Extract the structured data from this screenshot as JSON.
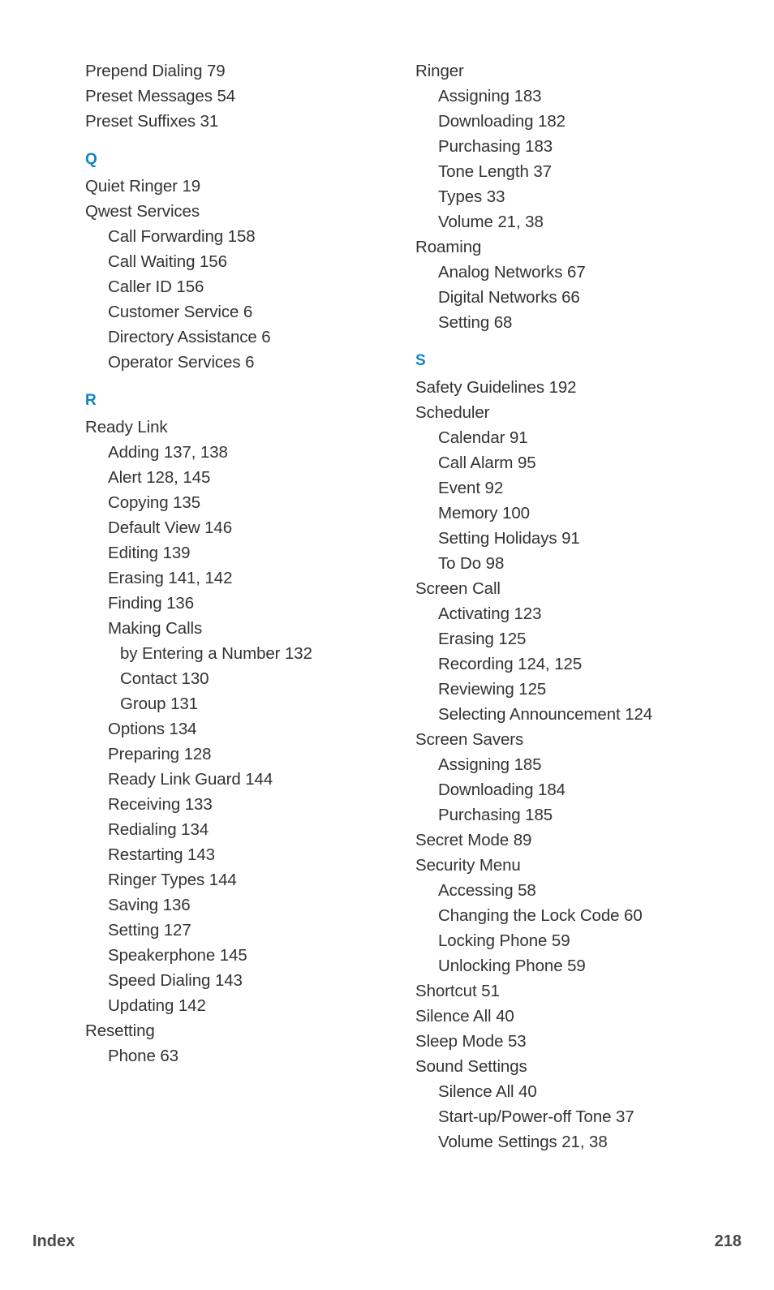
{
  "page": {
    "footer_label": "Index",
    "footer_page": "218",
    "accent_color": "#1283c3",
    "text_color": "#333333",
    "footer_color": "#4a4a4a",
    "background_color": "#ffffff"
  },
  "columns": [
    {
      "name": "left-column",
      "blocks": [
        {
          "type": "entry",
          "level": 1,
          "text": "Prepend Dialing 79"
        },
        {
          "type": "entry",
          "level": 1,
          "text": "Preset Messages 54"
        },
        {
          "type": "entry",
          "level": 1,
          "text": "Preset Suffixes 31"
        },
        {
          "type": "heading",
          "letter": "Q"
        },
        {
          "type": "entry",
          "level": 1,
          "text": "Quiet Ringer 19"
        },
        {
          "type": "entry",
          "level": 1,
          "text": "Qwest Services"
        },
        {
          "type": "entry",
          "level": 2,
          "text": "Call Forwarding 158"
        },
        {
          "type": "entry",
          "level": 2,
          "text": "Call Waiting 156"
        },
        {
          "type": "entry",
          "level": 2,
          "text": "Caller ID 156"
        },
        {
          "type": "entry",
          "level": 2,
          "text": "Customer Service 6"
        },
        {
          "type": "entry",
          "level": 2,
          "text": "Directory Assistance 6"
        },
        {
          "type": "entry",
          "level": 2,
          "text": "Operator Services 6"
        },
        {
          "type": "heading",
          "letter": "R"
        },
        {
          "type": "entry",
          "level": 1,
          "text": "Ready Link"
        },
        {
          "type": "entry",
          "level": 2,
          "text": "Adding 137, 138"
        },
        {
          "type": "entry",
          "level": 2,
          "text": "Alert 128, 145"
        },
        {
          "type": "entry",
          "level": 2,
          "text": "Copying 135"
        },
        {
          "type": "entry",
          "level": 2,
          "text": "Default View 146"
        },
        {
          "type": "entry",
          "level": 2,
          "text": "Editing 139"
        },
        {
          "type": "entry",
          "level": 2,
          "text": "Erasing 141, 142"
        },
        {
          "type": "entry",
          "level": 2,
          "text": "Finding 136"
        },
        {
          "type": "entry",
          "level": 2,
          "text": "Making Calls"
        },
        {
          "type": "entry",
          "level": 3,
          "text": "by Entering a Number 132"
        },
        {
          "type": "entry",
          "level": 3,
          "text": "Contact 130"
        },
        {
          "type": "entry",
          "level": 3,
          "text": "Group 131"
        },
        {
          "type": "entry",
          "level": 2,
          "text": "Options 134"
        },
        {
          "type": "entry",
          "level": 2,
          "text": "Preparing 128"
        },
        {
          "type": "entry",
          "level": 2,
          "text": "Ready Link Guard 144"
        },
        {
          "type": "entry",
          "level": 2,
          "text": "Receiving 133"
        },
        {
          "type": "entry",
          "level": 2,
          "text": "Redialing 134"
        },
        {
          "type": "entry",
          "level": 2,
          "text": "Restarting 143"
        },
        {
          "type": "entry",
          "level": 2,
          "text": "Ringer Types 144"
        },
        {
          "type": "entry",
          "level": 2,
          "text": "Saving 136"
        },
        {
          "type": "entry",
          "level": 2,
          "text": "Setting 127"
        },
        {
          "type": "entry",
          "level": 2,
          "text": "Speakerphone 145"
        },
        {
          "type": "entry",
          "level": 2,
          "text": "Speed Dialing 143"
        },
        {
          "type": "entry",
          "level": 2,
          "text": "Updating 142"
        },
        {
          "type": "entry",
          "level": 1,
          "text": "Resetting"
        },
        {
          "type": "entry",
          "level": 2,
          "text": "Phone 63"
        }
      ]
    },
    {
      "name": "right-column",
      "blocks": [
        {
          "type": "entry",
          "level": 1,
          "text": "Ringer"
        },
        {
          "type": "entry",
          "level": 2,
          "text": "Assigning 183"
        },
        {
          "type": "entry",
          "level": 2,
          "text": "Downloading 182"
        },
        {
          "type": "entry",
          "level": 2,
          "text": "Purchasing 183"
        },
        {
          "type": "entry",
          "level": 2,
          "text": "Tone Length 37"
        },
        {
          "type": "entry",
          "level": 2,
          "text": "Types 33"
        },
        {
          "type": "entry",
          "level": 2,
          "text": "Volume 21, 38"
        },
        {
          "type": "entry",
          "level": 1,
          "text": "Roaming"
        },
        {
          "type": "entry",
          "level": 2,
          "text": "Analog Networks 67"
        },
        {
          "type": "entry",
          "level": 2,
          "text": "Digital Networks 66"
        },
        {
          "type": "entry",
          "level": 2,
          "text": "Setting 68"
        },
        {
          "type": "heading",
          "letter": "S"
        },
        {
          "type": "entry",
          "level": 1,
          "text": "Safety Guidelines 192"
        },
        {
          "type": "entry",
          "level": 1,
          "text": "Scheduler"
        },
        {
          "type": "entry",
          "level": 2,
          "text": "Calendar 91"
        },
        {
          "type": "entry",
          "level": 2,
          "text": "Call Alarm 95"
        },
        {
          "type": "entry",
          "level": 2,
          "text": "Event 92"
        },
        {
          "type": "entry",
          "level": 2,
          "text": "Memory 100"
        },
        {
          "type": "entry",
          "level": 2,
          "text": "Setting Holidays 91"
        },
        {
          "type": "entry",
          "level": 2,
          "text": "To Do 98"
        },
        {
          "type": "entry",
          "level": 1,
          "text": "Screen Call"
        },
        {
          "type": "entry",
          "level": 2,
          "text": "Activating 123"
        },
        {
          "type": "entry",
          "level": 2,
          "text": "Erasing 125"
        },
        {
          "type": "entry",
          "level": 2,
          "text": "Recording 124, 125"
        },
        {
          "type": "entry",
          "level": 2,
          "text": "Reviewing 125"
        },
        {
          "type": "entry",
          "level": 2,
          "text": "Selecting Announcement 124"
        },
        {
          "type": "entry",
          "level": 1,
          "text": "Screen Savers"
        },
        {
          "type": "entry",
          "level": 2,
          "text": "Assigning 185"
        },
        {
          "type": "entry",
          "level": 2,
          "text": "Downloading 184"
        },
        {
          "type": "entry",
          "level": 2,
          "text": "Purchasing 185"
        },
        {
          "type": "entry",
          "level": 1,
          "text": "Secret Mode 89"
        },
        {
          "type": "entry",
          "level": 1,
          "text": "Security Menu"
        },
        {
          "type": "entry",
          "level": 2,
          "text": "Accessing 58"
        },
        {
          "type": "entry",
          "level": 2,
          "text": "Changing the Lock Code 60"
        },
        {
          "type": "entry",
          "level": 2,
          "text": "Locking Phone 59"
        },
        {
          "type": "entry",
          "level": 2,
          "text": "Unlocking Phone 59"
        },
        {
          "type": "entry",
          "level": 1,
          "text": "Shortcut 51"
        },
        {
          "type": "entry",
          "level": 1,
          "text": "Silence All 40"
        },
        {
          "type": "entry",
          "level": 1,
          "text": "Sleep Mode 53"
        },
        {
          "type": "entry",
          "level": 1,
          "text": "Sound Settings"
        },
        {
          "type": "entry",
          "level": 2,
          "text": "Silence All 40"
        },
        {
          "type": "entry",
          "level": 2,
          "text": "Start-up/Power-off Tone 37"
        },
        {
          "type": "entry",
          "level": 2,
          "text": "Volume Settings 21, 38"
        }
      ]
    }
  ]
}
